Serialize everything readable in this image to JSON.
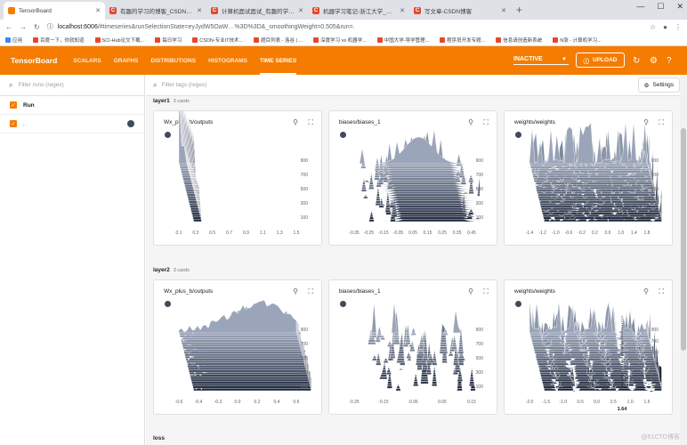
{
  "browser": {
    "tabs": [
      {
        "title": "TensorBoard",
        "active": true,
        "icon": "tensorboard"
      },
      {
        "title": "有趣的学习的博客_CSDN博客-Ja...",
        "icon": "csdn"
      },
      {
        "title": "计算机面试面试_有趣的学习的分...",
        "icon": "csdn"
      },
      {
        "title": "机器学习笔记-浙江大学_有趣的学...",
        "icon": "csdn"
      },
      {
        "title": "写文章-CSDN博客",
        "icon": "csdn"
      }
    ],
    "url_host": "localhost:6006",
    "url_path": "/#timeseries&runSelectionState=eyJydW5OaW…%3D%3D&_smoothingWeight=0.505&run=.",
    "bookmarks": [
      "应用",
      "百度一下，你就知道",
      "SCI-Hub论文下载...",
      "每日学习",
      "CSDN-专业IT技术...",
      "题目列表 - 洛谷 | ...",
      "深度学习 vs 机器学...",
      "中国大学-导学管理...",
      "程序员开发专题...",
      "信息请创造新系统",
      "N涨 - 计算机学习..."
    ]
  },
  "tensorboard": {
    "logo": "TensorBoard",
    "nav": [
      "SCALARS",
      "GRAPHS",
      "DISTRIBUTIONS",
      "HISTOGRAMS",
      "TIME SERIES"
    ],
    "active_nav": "TIME SERIES",
    "status": "INACTIVE",
    "upload_label": "UPLOAD",
    "accent": "#f57c00"
  },
  "sidebar": {
    "filter_placeholder": "Filter runs (regex)",
    "runs": [
      {
        "label": "Run"
      },
      {
        "label": "."
      }
    ]
  },
  "main": {
    "filter_placeholder": "Filter tags (regex)",
    "settings_label": "Settings",
    "groups": [
      {
        "name": "layer1",
        "count": "3 cards",
        "cards": [
          {
            "title": "Wx_plus_b/outputs",
            "ticks": [
              "0.1",
              "0.3",
              "0.5",
              "0.7",
              "0.9",
              "1.1",
              "1.3",
              "1.5"
            ],
            "steps": [
              "100",
              "300",
              "500",
              "700",
              "900"
            ]
          },
          {
            "title": "biases/biases_1",
            "ticks": [
              "-0.35",
              "-0.25",
              "-0.15",
              "-0.05",
              "0.05",
              "0.15",
              "0.25",
              "0.35",
              "0.45"
            ],
            "steps": [
              "100",
              "300",
              "500",
              "700",
              "900"
            ]
          },
          {
            "title": "weights/weights",
            "ticks": [
              "-1.4",
              "-1.2",
              "-1.0",
              "-0.6",
              "-0.2",
              "0.2",
              "0.6",
              "1.0",
              "1.4",
              "1.8"
            ],
            "steps": [
              "100",
              "300",
              "500",
              "700",
              "900"
            ]
          }
        ]
      },
      {
        "name": "layer2",
        "count": "3 cards",
        "cards": [
          {
            "title": "Wx_plus_b/outputs",
            "ticks": [
              "-0.6",
              "-0.4",
              "-0.2",
              "0.0",
              "0.2",
              "0.4",
              "0.6"
            ],
            "steps": [
              "100",
              "300",
              "500",
              "700",
              "900"
            ]
          },
          {
            "title": "biases/biases_1",
            "ticks": [
              "-0.25",
              "-0.15",
              "-0.05",
              "0.05",
              "0.15"
            ],
            "steps": [
              "100",
              "300",
              "500",
              "700",
              "900"
            ]
          },
          {
            "title": "weights/weights",
            "ticks": [
              "-2.0",
              "-1.5",
              "-1.0",
              "-0.5",
              "0.0",
              "0.5",
              "1.0",
              "1.5"
            ],
            "steps": [
              "100",
              "250",
              "300",
              "500",
              "700",
              "900"
            ],
            "hover_step": "250",
            "hover_x": "1.64"
          }
        ]
      },
      {
        "name": "loss"
      }
    ]
  },
  "watermark": "@51CTO博客"
}
